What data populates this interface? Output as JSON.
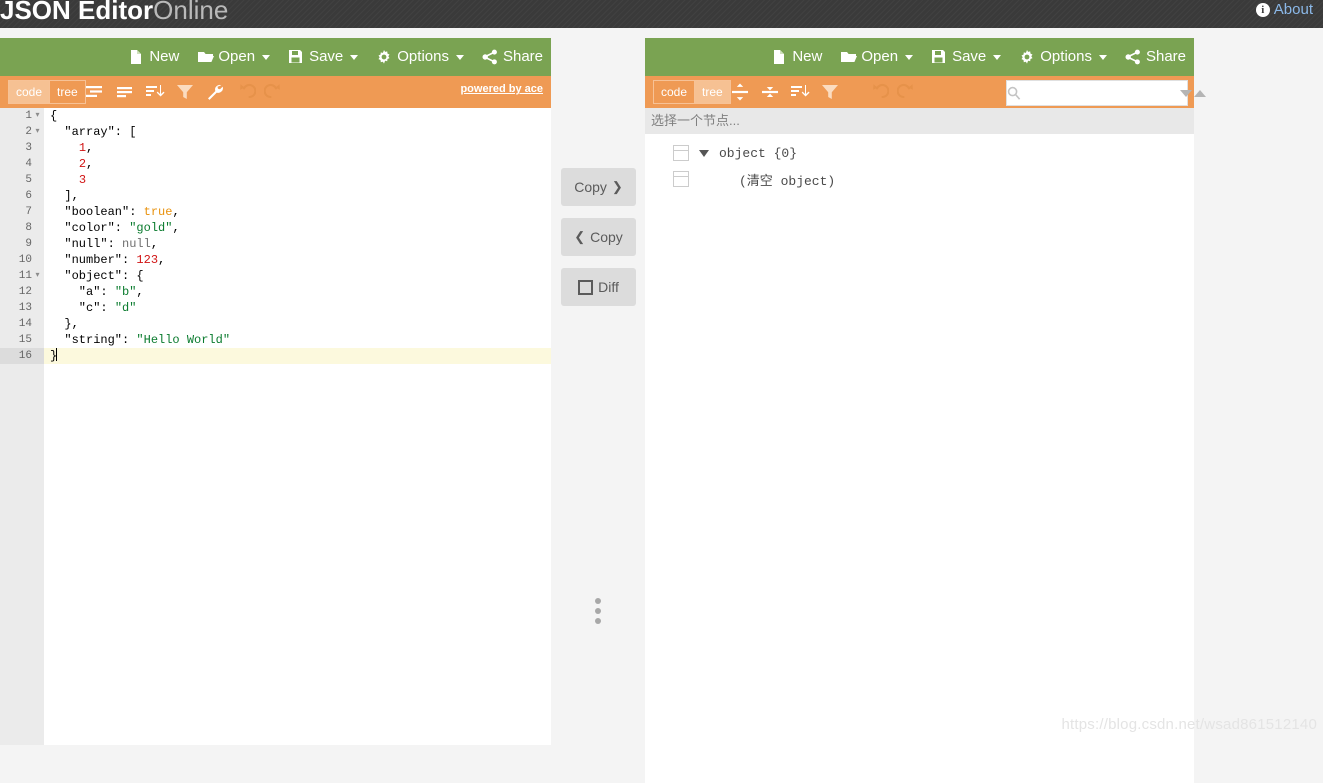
{
  "header": {
    "title_bold": "JSON Editor",
    "title_light": "Online",
    "about_label": "About",
    "about_icon": "info-icon",
    "bg_color": "#3a3a3a"
  },
  "theme": {
    "menubar_green": "#7aa352",
    "toolbar_orange": "#ef9a54",
    "page_bg": "#f4f4f4",
    "active_line": "#fcf9dd",
    "about_link": "#8bb8e8"
  },
  "left_panel": {
    "menu": [
      {
        "label": "New",
        "icon": "new-file-icon",
        "caret": false
      },
      {
        "label": "Open",
        "icon": "folder-open-icon",
        "caret": true
      },
      {
        "label": "Save",
        "icon": "floppy-disk-icon",
        "caret": true
      },
      {
        "label": "Options",
        "icon": "gear-icon",
        "caret": true
      },
      {
        "label": "Share",
        "icon": "share-icon",
        "caret": false
      }
    ],
    "modes": [
      {
        "label": "code",
        "active": true
      },
      {
        "label": "tree",
        "active": false
      }
    ],
    "tool_icons": [
      "format-indent-icon",
      "compact-icon",
      "sort-icon",
      "filter-icon",
      "wrench-icon",
      "undo-icon",
      "redo-icon"
    ],
    "powered_by": "powered by ace",
    "editor": {
      "lines": [
        {
          "num": "1",
          "fold": "▾",
          "indent": 0,
          "tokens": [
            {
              "t": "{",
              "c": "k"
            }
          ]
        },
        {
          "num": "2",
          "fold": "▾",
          "indent": 0,
          "tokens": [
            {
              "t": "  \"array\": [",
              "c": "k"
            }
          ]
        },
        {
          "num": "3",
          "fold": "",
          "indent": 1,
          "tokens": [
            {
              "t": "    ",
              "c": "k"
            },
            {
              "t": "1",
              "c": "n"
            },
            {
              "t": ",",
              "c": "k"
            }
          ]
        },
        {
          "num": "4",
          "fold": "",
          "indent": 1,
          "tokens": [
            {
              "t": "    ",
              "c": "k"
            },
            {
              "t": "2",
              "c": "n"
            },
            {
              "t": ",",
              "c": "k"
            }
          ]
        },
        {
          "num": "5",
          "fold": "",
          "indent": 1,
          "tokens": [
            {
              "t": "    ",
              "c": "k"
            },
            {
              "t": "3",
              "c": "n"
            }
          ]
        },
        {
          "num": "6",
          "fold": "",
          "indent": 0,
          "tokens": [
            {
              "t": "  ],",
              "c": "k"
            }
          ]
        },
        {
          "num": "7",
          "fold": "",
          "indent": 0,
          "tokens": [
            {
              "t": "  \"boolean\": ",
              "c": "k"
            },
            {
              "t": "true",
              "c": "bl"
            },
            {
              "t": ",",
              "c": "k"
            }
          ]
        },
        {
          "num": "8",
          "fold": "",
          "indent": 0,
          "tokens": [
            {
              "t": "  \"color\": ",
              "c": "k"
            },
            {
              "t": "\"gold\"",
              "c": "s"
            },
            {
              "t": ",",
              "c": "k"
            }
          ]
        },
        {
          "num": "9",
          "fold": "",
          "indent": 0,
          "tokens": [
            {
              "t": "  \"null\": ",
              "c": "k"
            },
            {
              "t": "null",
              "c": "nu"
            },
            {
              "t": ",",
              "c": "k"
            }
          ]
        },
        {
          "num": "10",
          "fold": "",
          "indent": 0,
          "tokens": [
            {
              "t": "  \"number\": ",
              "c": "k"
            },
            {
              "t": "123",
              "c": "n"
            },
            {
              "t": ",",
              "c": "k"
            }
          ]
        },
        {
          "num": "11",
          "fold": "▾",
          "indent": 0,
          "tokens": [
            {
              "t": "  \"object\": {",
              "c": "k"
            }
          ]
        },
        {
          "num": "12",
          "fold": "",
          "indent": 1,
          "tokens": [
            {
              "t": "    \"a\": ",
              "c": "k"
            },
            {
              "t": "\"b\"",
              "c": "s"
            },
            {
              "t": ",",
              "c": "k"
            }
          ]
        },
        {
          "num": "13",
          "fold": "",
          "indent": 1,
          "tokens": [
            {
              "t": "    \"c\": ",
              "c": "k"
            },
            {
              "t": "\"d\"",
              "c": "s"
            }
          ]
        },
        {
          "num": "14",
          "fold": "",
          "indent": 0,
          "tokens": [
            {
              "t": "  },",
              "c": "k"
            }
          ]
        },
        {
          "num": "15",
          "fold": "",
          "indent": 0,
          "tokens": [
            {
              "t": "  \"string\": ",
              "c": "k"
            },
            {
              "t": "\"Hello World\"",
              "c": "s"
            }
          ]
        },
        {
          "num": "16",
          "fold": "",
          "indent": 0,
          "current": true,
          "tokens": [
            {
              "t": "}",
              "c": "k"
            }
          ]
        }
      ]
    }
  },
  "middle": {
    "buttons": [
      {
        "label": "Copy",
        "icon": "chevron-right-icon",
        "icon_side": "right",
        "name": "copy-right-button"
      },
      {
        "label": "Copy",
        "icon": "chevron-left-icon",
        "icon_side": "left",
        "name": "copy-left-button"
      },
      {
        "label": "Diff",
        "icon": "square-icon",
        "icon_side": "left",
        "name": "diff-button"
      }
    ],
    "drag_handle": "vertical-dots-icon"
  },
  "right_panel": {
    "menu": [
      {
        "label": "New",
        "icon": "new-file-icon",
        "caret": false
      },
      {
        "label": "Open",
        "icon": "folder-open-icon",
        "caret": true
      },
      {
        "label": "Save",
        "icon": "floppy-disk-icon",
        "caret": true
      },
      {
        "label": "Options",
        "icon": "gear-icon",
        "caret": true
      },
      {
        "label": "Share",
        "icon": "share-icon",
        "caret": false
      }
    ],
    "modes": [
      {
        "label": "code",
        "active": false
      },
      {
        "label": "tree",
        "active": true
      }
    ],
    "tool_icons": [
      "expand-all-icon",
      "collapse-all-icon",
      "sort-icon",
      "filter-icon",
      "undo-icon",
      "redo-icon"
    ],
    "search": {
      "value": "",
      "placeholder": "",
      "icon": "search-icon",
      "next_icon": "triangle-down-icon",
      "prev_icon": "triangle-up-icon"
    },
    "status_text": "选择一个节点...",
    "tree": {
      "root_label": "object {0}",
      "root_expanded": true,
      "child_label": "(清空 object)"
    }
  },
  "watermark": "https://blog.csdn.net/wsad861512140"
}
